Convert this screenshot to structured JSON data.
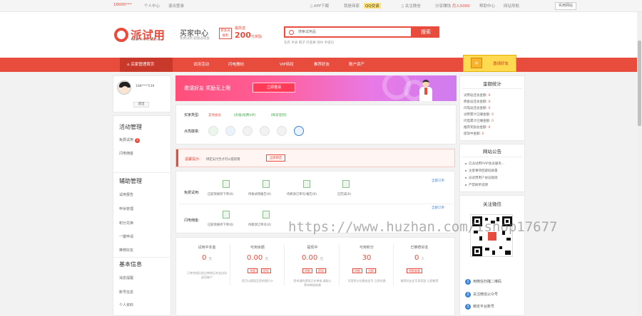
{
  "topbar": {
    "phone": "18005***",
    "personal_center": "个人中心",
    "logout": "退出登录",
    "app_download": "APP下载",
    "merchant_login": "我是商家",
    "qq_login": "QQ交谈",
    "follow_wechat": "关注微信",
    "share_earn": "分享赚钱",
    "share_amount": "月入5000",
    "help_center": "帮助中心",
    "site_nav": "网站导航",
    "quick_link": "实用网站"
  },
  "header": {
    "logo_text": "派试用",
    "logo_sub": "PAISHIYONG.COM",
    "buyer_center": "买家中心",
    "buyer_sub": "免费试用 超级返现金",
    "badge": "新会员福利",
    "badge_amount_prefix": "最高送",
    "badge_amount": "200",
    "badge_amount_suffix": "元奖励",
    "search_placeholder": "搜索试用品",
    "search_button": "搜索",
    "hot_words": "毛衣  手表 鞋子  打底裤 围巾  手提包"
  },
  "nav": {
    "home": "买家管理首页",
    "items": [
      "试用活动",
      "闪电撸帖",
      "VIP特权",
      "推荐好友",
      "账户资产"
    ],
    "invite": "邀请好友"
  },
  "sidebar": {
    "username": "188****539",
    "logout": "退出",
    "sections": [
      {
        "title": "活动管理",
        "items": [
          "免费试用",
          "闪电佣金"
        ],
        "count": "2"
      },
      {
        "title": "辅助管理",
        "items": [
          "试用报告",
          "申诉管理",
          "积分兑换",
          "一键申请",
          "推荐好友"
        ]
      },
      {
        "title": "基本信息",
        "items": [
          "消息提醒",
          "账号信息",
          "个人资料"
        ]
      }
    ]
  },
  "banner": {
    "text": "邀请好友  奖励无上限",
    "button": "立即邀请"
  },
  "buyer_info": {
    "type_label": "买家类型:",
    "type_value": "支持会员",
    "upgrade": "[升级/续费VIP]",
    "check_in": "[每日签到]",
    "bind_label": "点亮徽章:"
  },
  "warning": {
    "label": "温馨提示:",
    "text": "绑定支付宝才可以提现哦",
    "button": "立即绑定"
  },
  "free_trial": {
    "label": "免费试用:",
    "all_orders": "全部订单",
    "steps": [
      "已获资格待下单(0)",
      "待依试用报告(0)",
      "待修改订单号/报告(0)",
      "已完成(0)"
    ]
  },
  "flash": {
    "label": "闪电佣金:",
    "all_orders": "全部订单",
    "steps": [
      "已获资格待下单(0)",
      "待修改订单号(0)"
    ]
  },
  "stats": [
    {
      "title": "试用中本金",
      "value": "0",
      "unit": "元",
      "note": "订单完成后经过审核后本金自动返回账户"
    },
    {
      "title": "可用余额",
      "value": "0.00",
      "unit": "元",
      "buttons": [
        "充值",
        "提现"
      ],
      "note": "您可以提现至您的银行卡"
    },
    {
      "title": "提现中",
      "value": "0.00",
      "unit": "元",
      "buttons": [
        "明细",
        "提现"
      ],
      "note": "您申请的提现正在审核,请耐心等待审核结果"
    },
    {
      "title": "可用积分",
      "value": "30",
      "unit": "",
      "buttons": [
        "明细",
        "兑换"
      ],
      "note": "可用积分兑换成金币 立即兑换"
    },
    {
      "title": "已推荐好友",
      "value": "0",
      "unit": "人",
      "buttons": [
        "明细查看"
      ],
      "note": "推荐好友还可享奖励 立即推荐"
    }
  ],
  "finance": {
    "title": "金额统计",
    "lines": [
      {
        "label": "试用返还总金额:",
        "value": "0"
      },
      {
        "label": "佣金返还总金额:",
        "value": "0"
      },
      {
        "label": "闪电返还总金额:",
        "value": "0"
      },
      {
        "label": "试用累计已赚金额:",
        "value": "0"
      },
      {
        "label": "闪电累计已赚金额:",
        "value": "0"
      },
      {
        "label": "推荐奖励总金额:",
        "value": "0"
      },
      {
        "label": "提现中金额:",
        "value": "0"
      }
    ]
  },
  "notice": {
    "title": "网站公告",
    "items": [
      "已派试用PVIP会员服务...",
      "注意事项回避低质量",
      "派试用用户协议规则",
      "严禁刷单说明"
    ]
  },
  "wechat": {
    "title": "关注微信",
    "steps": [
      "用微信扫描二维码",
      "关注微信公众号",
      "绑定平台账号"
    ]
  },
  "watermark": "https://www.huzhan.com/ishop17677",
  "colors": {
    "accent": "#e84c3d",
    "banner_pink": "#ff5f9a",
    "link_blue": "#3b85d8"
  }
}
